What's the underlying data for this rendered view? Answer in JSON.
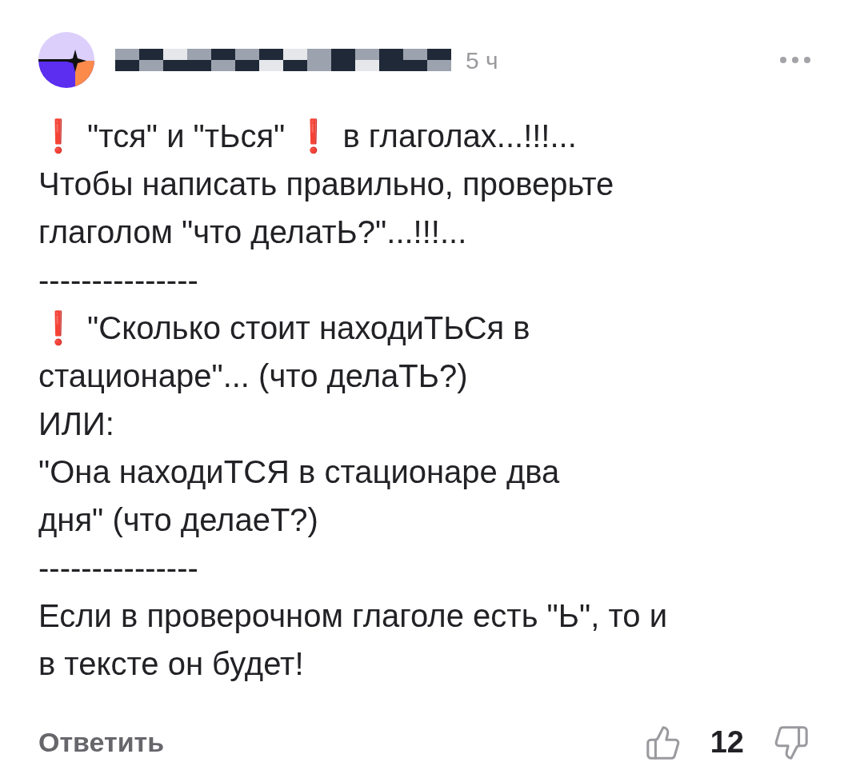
{
  "comment": {
    "time": "5 ч",
    "lines": [
      [
        {
          "kind": "mark",
          "text": "❗"
        },
        {
          "kind": "text",
          "text": " \"тся\" и \"тЬся\" "
        },
        {
          "kind": "mark",
          "text": "❗"
        },
        {
          "kind": "text",
          "text": " в глаголах...!!!..."
        }
      ],
      [
        {
          "kind": "text",
          "text": "Чтобы написать правильно, проверьте"
        }
      ],
      [
        {
          "kind": "text",
          "text": "глаголом \"что делатЬ?\"...!!!..."
        }
      ],
      [
        {
          "kind": "text",
          "text": "---------------"
        }
      ],
      [
        {
          "kind": "mark",
          "text": "❗"
        },
        {
          "kind": "text",
          "text": " \"Сколько стоит находиТЬСя в"
        }
      ],
      [
        {
          "kind": "text",
          "text": "стационаре\"... (что делаТЬ?)"
        }
      ],
      [
        {
          "kind": "text",
          "text": "ИЛИ:"
        }
      ],
      [
        {
          "kind": "text",
          "text": "\"Она находиТСЯ в стационаре два"
        }
      ],
      [
        {
          "kind": "text",
          "text": "дня\" (что делаеТ?)"
        }
      ],
      [
        {
          "kind": "text",
          "text": "---------------"
        }
      ],
      [
        {
          "kind": "text",
          "text": "Если в проверочном глаголе есть \"Ь\", то и"
        }
      ],
      [
        {
          "kind": "text",
          "text": "в тексте он будет!"
        }
      ]
    ],
    "reply": "Ответить",
    "score": "12"
  }
}
